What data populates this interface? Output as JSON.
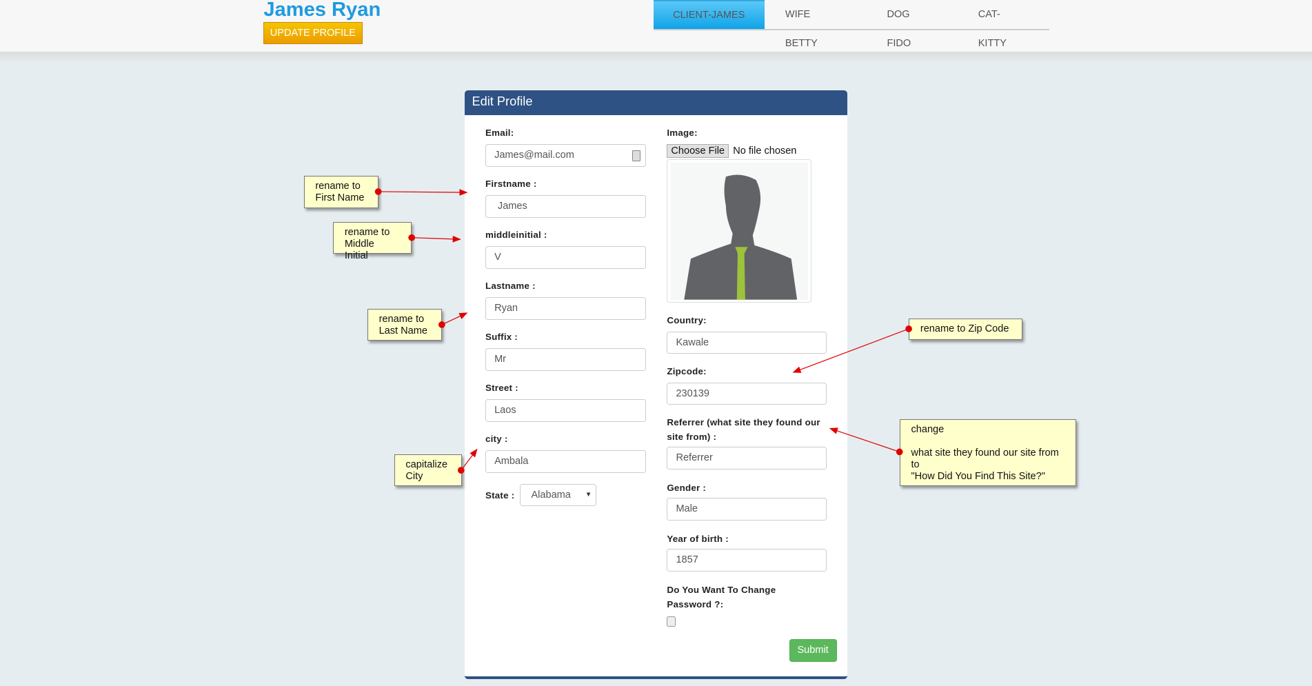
{
  "header": {
    "name": "James Ryan",
    "update_button": "UPDATE PROFILE",
    "tabs": [
      {
        "label": "CLIENT-JAMES",
        "active": true
      },
      {
        "label": "WIFE BETTY"
      },
      {
        "label": "DOG FIDO"
      },
      {
        "label": "CAT-KITTY"
      }
    ]
  },
  "form": {
    "title": "Edit Profile",
    "email": {
      "label": "Email:",
      "value": "James@mail.com"
    },
    "firstname": {
      "label": "Firstname :",
      "value": "James"
    },
    "middleinitial": {
      "label": "middleinitial :",
      "value": "V"
    },
    "lastname": {
      "label": "Lastname :",
      "value": "Ryan"
    },
    "suffix": {
      "label": "Suffix :",
      "value": "Mr"
    },
    "street": {
      "label": "Street :",
      "value": "Laos"
    },
    "city": {
      "label": "city :",
      "value": "Ambala"
    },
    "state": {
      "label": "State :",
      "value": "Alabama"
    },
    "image": {
      "label": "Image:",
      "choose": "Choose File",
      "status": "No file chosen"
    },
    "country": {
      "label": "Country:",
      "value": "Kawale"
    },
    "zipcode": {
      "label": "Zipcode:",
      "value": "230139"
    },
    "referrer": {
      "label": "Referrer (what site they found our site from) :",
      "placeholder": "Referrer"
    },
    "gender": {
      "label": "Gender :",
      "value": "Male"
    },
    "year": {
      "label": "Year of birth :",
      "value": "1857"
    },
    "password": {
      "label": "Do You Want To Change Password ?:",
      "checked": false
    },
    "submit": "Submit"
  },
  "annotations": [
    "rename to\nFirst Name",
    "rename to\nMiddle Initial",
    "rename to\nLast Name",
    "capitalize\nCity",
    "rename to Zip Code",
    "change\n\nwhat site they found our site from\nto\n\"How Did You Find This Site?\""
  ],
  "colors": {
    "accent": "#1e9ae0",
    "panel": "#2e5283",
    "submit": "#5cb85c",
    "note": "#ffffcc",
    "arrow": "#e00000"
  }
}
